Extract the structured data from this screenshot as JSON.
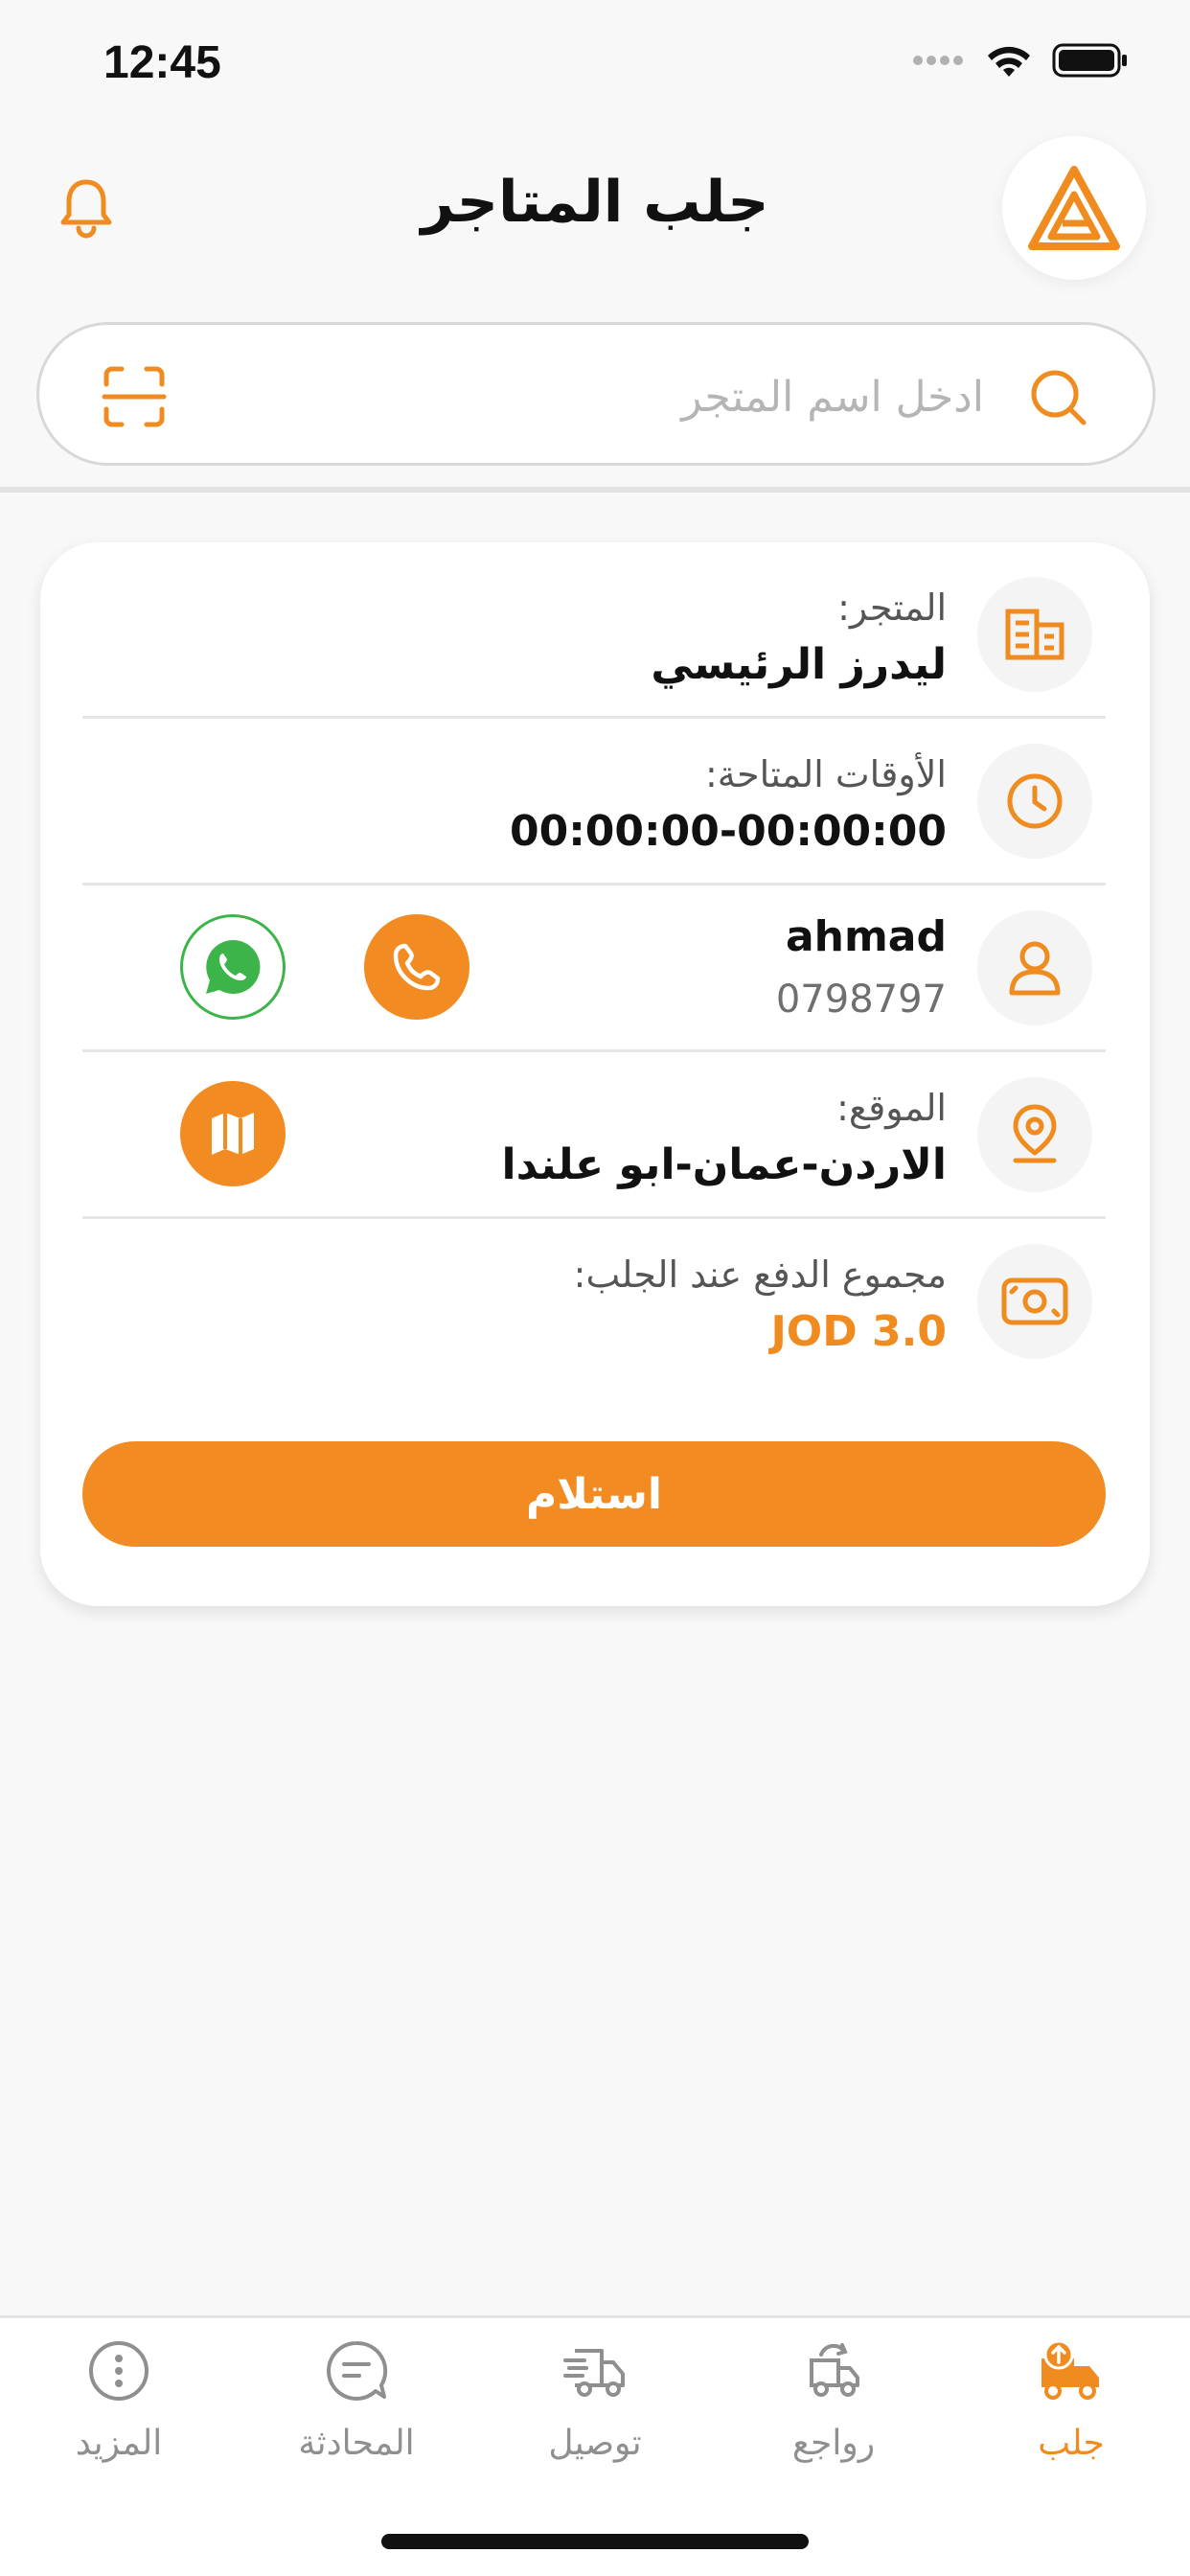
{
  "status": {
    "time": "12:45"
  },
  "header": {
    "title": "جلب المتاجر"
  },
  "search": {
    "placeholder": "ادخل اسم المتجر"
  },
  "card": {
    "store": {
      "label": "المتجر:",
      "value": "ليدرز الرئيسي"
    },
    "hours": {
      "label": "الأوقات المتاحة:",
      "value": "00:00:00-00:00:00"
    },
    "contact": {
      "name": "ahmad",
      "phone": "0798797"
    },
    "location": {
      "label": "الموقع:",
      "value": "الاردن-عمان-ابو علندا"
    },
    "payment": {
      "label": "مجموع الدفع عند الجلب:",
      "value": "JOD 3.0"
    },
    "receive_label": "استلام"
  },
  "nav": {
    "items": [
      {
        "label": "جلب",
        "icon": "pickup-truck-icon",
        "active": true
      },
      {
        "label": "رواجع",
        "icon": "returns-truck-icon",
        "active": false
      },
      {
        "label": "توصيل",
        "icon": "delivery-truck-icon",
        "active": false
      },
      {
        "label": "المحادثة",
        "icon": "chat-icon",
        "active": false
      },
      {
        "label": "المزيد",
        "icon": "more-icon",
        "active": false
      }
    ]
  },
  "colors": {
    "accent": "#f28c22",
    "whatsapp": "#3cb44a",
    "muted": "#8f8f8f"
  }
}
